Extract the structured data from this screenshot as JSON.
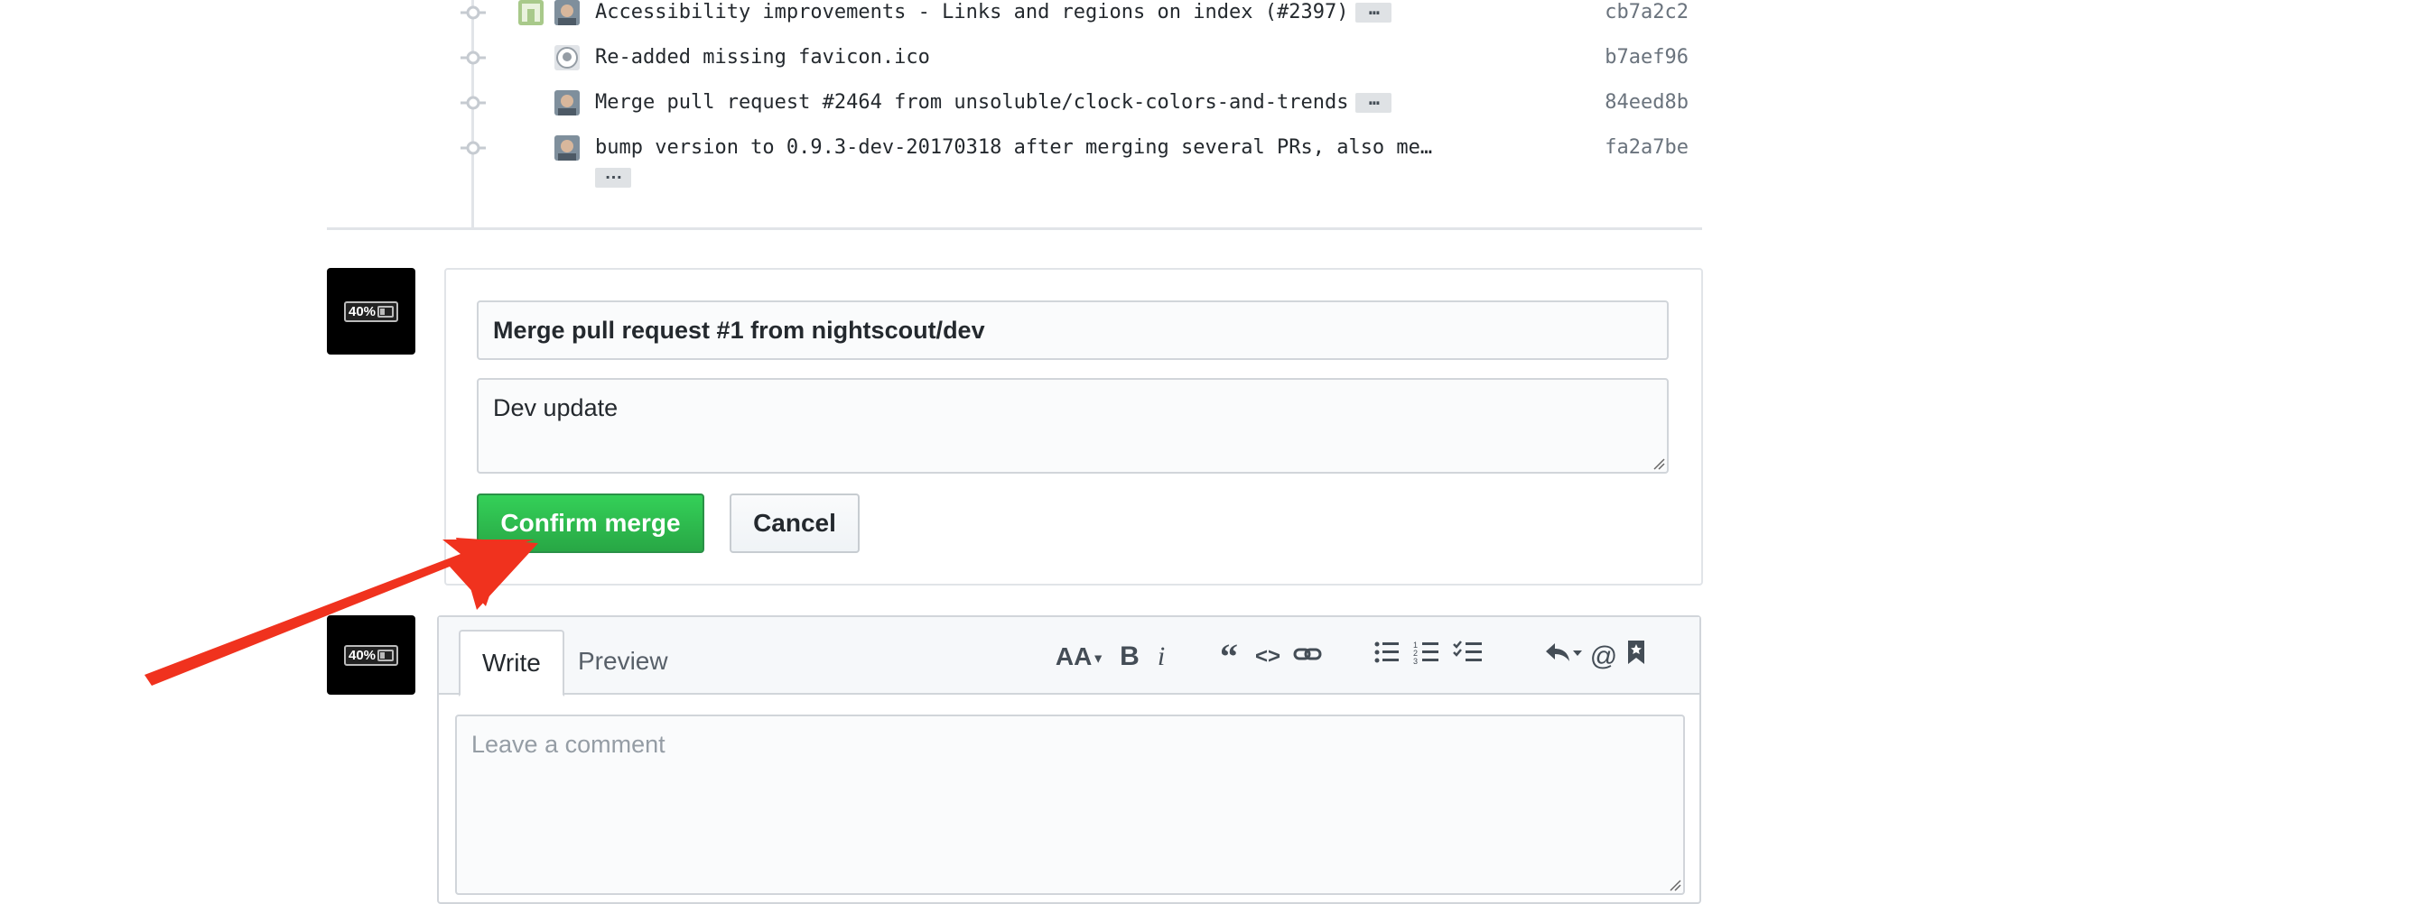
{
  "commits": [
    {
      "message": "Accessibility improvements - Links and regions on index (#2397)",
      "sha": "cb7a2c2",
      "has_ellipsis": true
    },
    {
      "message": "Re-added missing favicon.ico",
      "sha": "b7aef96",
      "has_ellipsis": false
    },
    {
      "message": "Merge pull request #2464 from unsoluble/clock-colors-and-trends",
      "sha": "84eed8b",
      "has_ellipsis": true
    },
    {
      "message": "bump version to 0.9.3-dev-20170318 after merging several PRs, also me…",
      "sha": "fa2a7be",
      "has_ellipsis": true
    }
  ],
  "ellipsis_label": "…",
  "avatar_badge": "40%",
  "merge_form": {
    "title_value": "Merge pull request #1 from nightscout/dev",
    "body_value": "Dev update",
    "confirm_label": "Confirm merge",
    "cancel_label": "Cancel"
  },
  "comment": {
    "tab_write": "Write",
    "tab_preview": "Preview",
    "placeholder": "Leave a comment",
    "toolbar": {
      "header": "AA",
      "bold": "B",
      "italic": "i",
      "quote": "“",
      "code": "<>",
      "mention": "@"
    }
  },
  "colors": {
    "confirm_green": "#2ea44f",
    "annotation_arrow": "#f0321e",
    "sha_gray": "#6a737d"
  }
}
